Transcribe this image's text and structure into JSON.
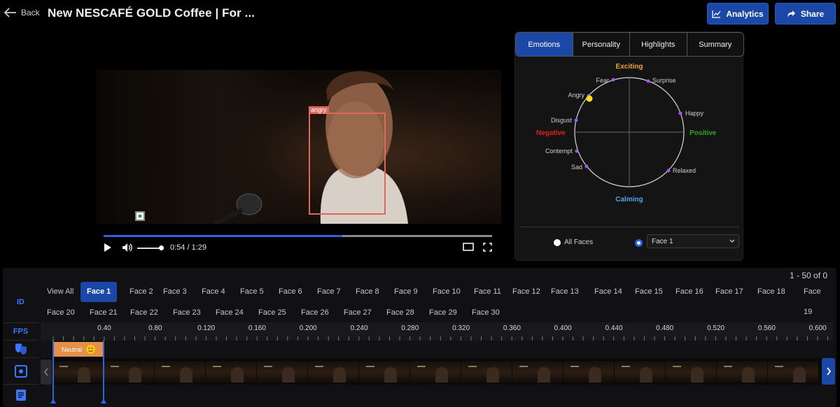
{
  "header": {
    "back_label": "Back",
    "title": "New NESCAFÉ GOLD Coffee | For ...",
    "analytics_label": "Analytics",
    "share_label": "Share"
  },
  "video": {
    "face_label": "angry",
    "time_display": "0:54 / 1:29",
    "progress": 0.615,
    "volume": 0.9
  },
  "panel": {
    "tabs": [
      {
        "label": "Emotions",
        "active": true
      },
      {
        "label": "Personality",
        "active": false
      },
      {
        "label": "Highlights",
        "active": false
      },
      {
        "label": "Summary",
        "active": false
      }
    ],
    "wheel": {
      "top_label": "Exciting",
      "bottom_label": "Calming",
      "left_label": "Negative",
      "right_label": "Positive",
      "top_color": "#f0a030",
      "bottom_color": "#4da6e8",
      "left_color": "#e02020",
      "right_color": "#2aa52a",
      "point_color": "#a855f7",
      "marker_color": "#f5e01a",
      "emotions": [
        "Fear",
        "Surprise",
        "Angry",
        "Happy",
        "Disgust",
        "Contempt",
        "Sad",
        "Relaxed"
      ]
    },
    "all_faces_label": "All Faces",
    "face_select_value": "Face 1"
  },
  "timeline": {
    "count_label": "1 - 50 of 0",
    "side_labels": {
      "id": "ID",
      "fps": "FPS"
    },
    "faces": [
      "View All",
      "Face 1",
      "Face 2",
      "Face 3",
      "Face 4",
      "Face 5",
      "Face 6",
      "Face 7",
      "Face 8",
      "Face 9",
      "Face 10",
      "Face 11",
      "Face 12",
      "Face 13",
      "Face 14",
      "Face 15",
      "Face 16",
      "Face 17",
      "Face 18",
      "Face 19",
      "Face 20",
      "Face 21",
      "Face 22",
      "Face 23",
      "Face 24",
      "Face 25",
      "Face 26",
      "Face 27",
      "Face 28",
      "Face 29",
      "Face 30"
    ],
    "active_face": "Face 1",
    "ruler_labels": [
      "0.40",
      "0.80",
      "0.120",
      "0.160",
      "0.200",
      "0.240",
      "0.280",
      "0.320",
      "0.360",
      "0.400",
      "0.440",
      "0.480",
      "0.520",
      "0.560",
      "0.600"
    ],
    "emotion_segment": "Neutral",
    "thumbnail_count": 15
  },
  "colors": {
    "accent": "#1b47a6",
    "face_box": "#e0685a",
    "segment": "#e3904a"
  }
}
